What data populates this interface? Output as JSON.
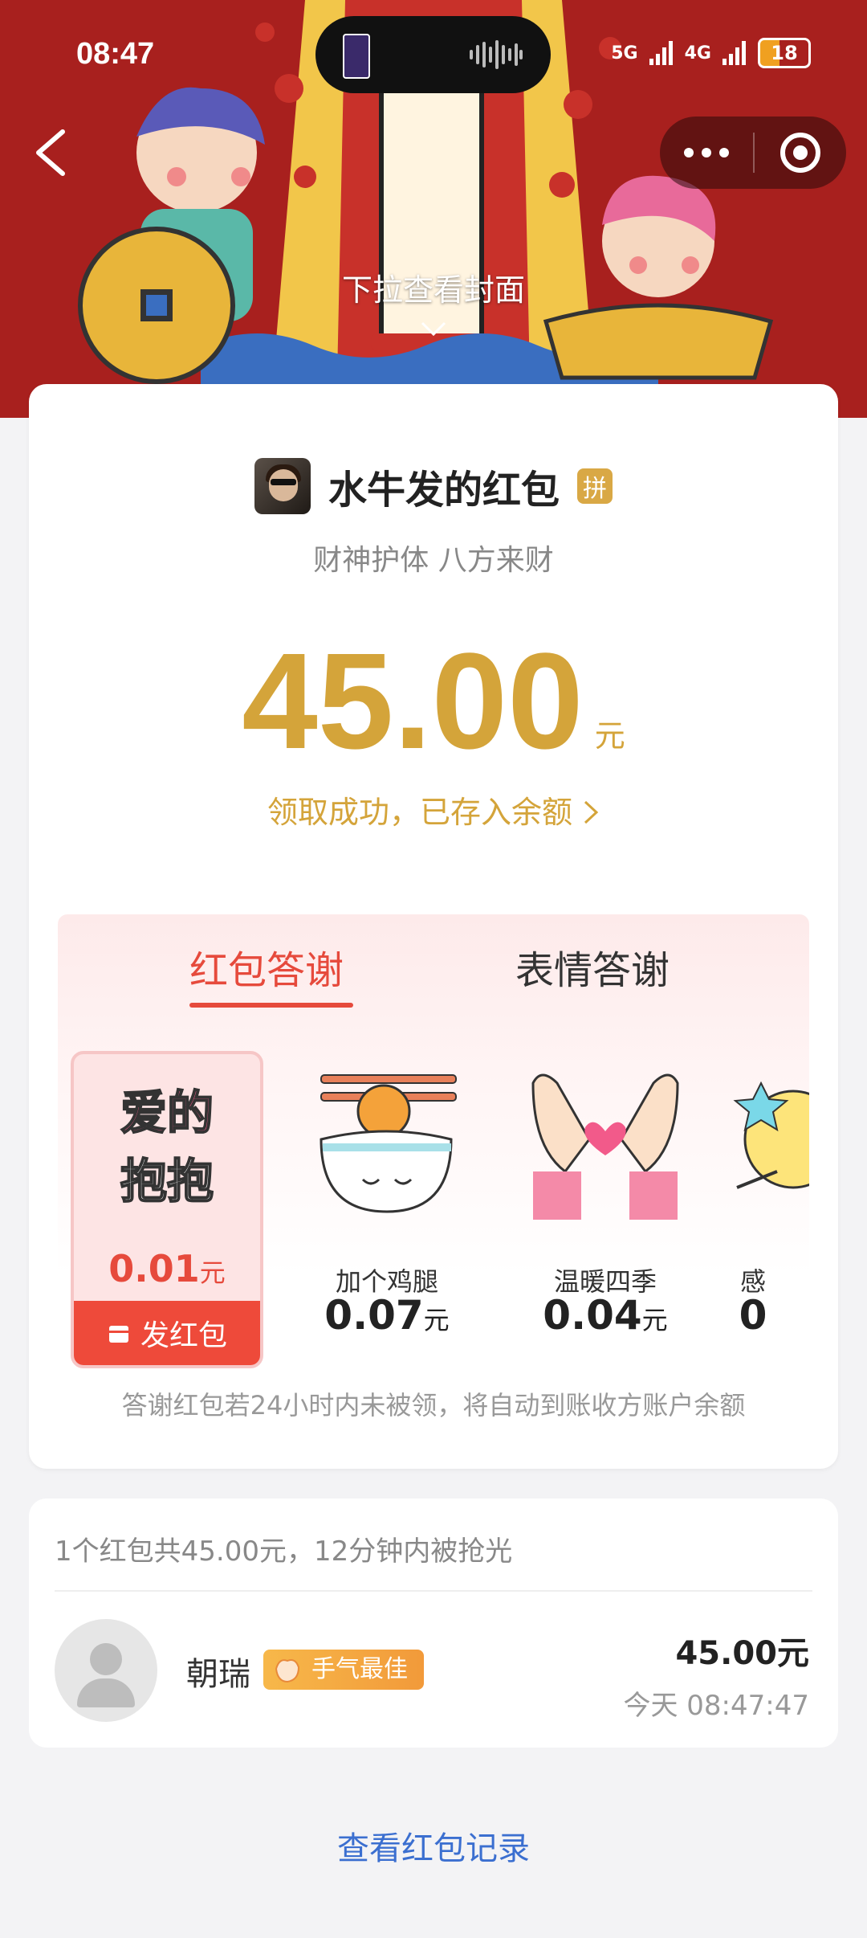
{
  "status_bar": {
    "time": "08:47",
    "network1": "5G",
    "network2": "4G",
    "battery": "18"
  },
  "header": {
    "pull_hint": "下拉查看封面"
  },
  "packet": {
    "sender_name": "水牛发的红包",
    "pin_badge": "拼",
    "blessing": "财神护体 八方来财",
    "amount": "45.00",
    "amount_unit": "元",
    "claim_status": "领取成功，已存入余额"
  },
  "thanks": {
    "tabs": [
      {
        "label": "红包答谢",
        "active": true
      },
      {
        "label": "表情答谢",
        "active": false
      }
    ],
    "gifts": [
      {
        "title": "",
        "art_text": "爱的抱抱",
        "price": "0.01",
        "unit": "元",
        "selected": true,
        "icon": "hug-sticker"
      },
      {
        "title": "加个鸡腿",
        "price": "0.07",
        "unit": "元",
        "icon": "rice-bowl-drumstick-icon"
      },
      {
        "title": "温暖四季",
        "price": "0.04",
        "unit": "元",
        "icon": "heart-hands-icon"
      },
      {
        "title": "感",
        "price": "0",
        "unit": "",
        "icon": "star-icon"
      }
    ],
    "send_button": "发红包",
    "note": "答谢红包若24小时内未被领，将自动到账收方账户余额"
  },
  "records": {
    "summary": "1个红包共45.00元，12分钟内被抢光",
    "items": [
      {
        "name": "朝瑞",
        "badge": "手气最佳",
        "amount": "45.00元",
        "time": "今天 08:47:47"
      }
    ]
  },
  "footer": {
    "view_history": "查看红包记录"
  },
  "colors": {
    "gold": "#d4a43a",
    "red": "#e64a3c",
    "link": "#3b6fd0"
  }
}
